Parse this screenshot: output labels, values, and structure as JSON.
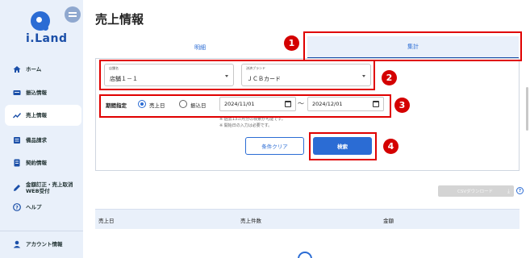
{
  "sidebar": {
    "logo_text": "i.Land",
    "items": [
      {
        "label": "ホーム",
        "icon": "home-icon"
      },
      {
        "label": "振込情報",
        "icon": "transfer-icon"
      },
      {
        "label": "売上情報",
        "icon": "trend-icon",
        "active": true
      },
      {
        "label": "備品請求",
        "icon": "supplies-icon"
      },
      {
        "label": "契約情報",
        "icon": "contract-icon"
      },
      {
        "label": "金額訂正・売上取消\nWEB受付",
        "icon": "pencil-icon"
      },
      {
        "label": "ヘルプ",
        "icon": "help-icon"
      }
    ],
    "account_label": "アカウント情報"
  },
  "page_title": "売上情報",
  "tabs": {
    "detail": "明細",
    "summary": "集計"
  },
  "form": {
    "store": {
      "label": "店舗名",
      "value": "店舗１－１"
    },
    "brand": {
      "label": "決済ブランド",
      "value": "ＪＣＢカード"
    },
    "period_label": "期間指定",
    "radio_sales_date": "売上日",
    "radio_transfer_date": "振込日",
    "date_from": "2024/11/01",
    "date_to": "2024/12/01",
    "tilde": "～",
    "note1": "※ 過去13カ月分の検索が可能です。",
    "note2": "※ 開始日の入力は必要です。",
    "clear_button": "条件クリア",
    "search_button": "検索"
  },
  "csv_button": "CSVダウンロード",
  "table": {
    "columns": [
      "売上日",
      "売上件数",
      "金額"
    ]
  },
  "annotations": [
    "1",
    "2",
    "3",
    "4"
  ],
  "colors": {
    "accent": "#2b6cd4",
    "annotation": "#e00000",
    "sidebar_bg": "#e9f0fa"
  }
}
